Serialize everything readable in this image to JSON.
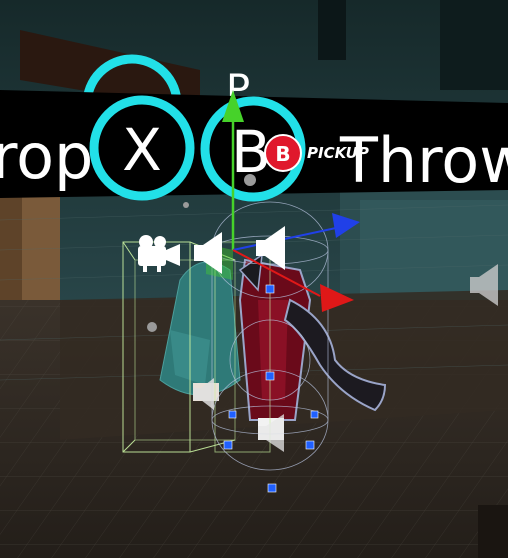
{
  "hud": {
    "drop_partial": "rop",
    "x_button_label": "X",
    "b_button_partial": "B",
    "throw_label": "Throw",
    "b_badge_label": "B",
    "pickup_label": "PICKUP",
    "behind_partial_1": "-",
    "behind_partial_2": "P"
  },
  "colors": {
    "hud_ring": "#22e0e8",
    "hud_band": "#000000",
    "badge_red": "#e0182c",
    "gizmo_y": "#46d22a",
    "gizmo_z": "#2040e8",
    "gizmo_x": "#e01818",
    "collider_green": "#c8f0a0",
    "handle_blue": "#2060ff",
    "floor": "#2a2520",
    "wall_teal": "#1f3b3d"
  },
  "icons": {
    "camera": "camera-icon",
    "audio_sources": "speaker-icon",
    "move_gizmo": "move-gizmo-icon",
    "x_ring": "ring-icon"
  }
}
